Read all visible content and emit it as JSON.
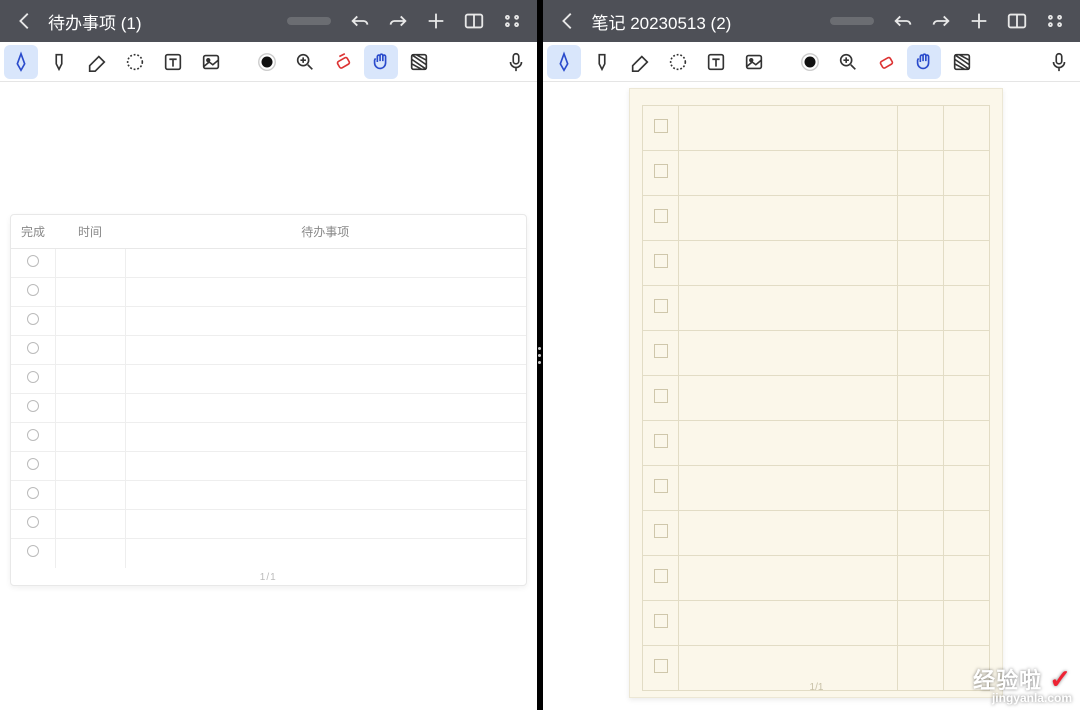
{
  "left": {
    "title": "待办事项 (1)",
    "todo": {
      "headers": {
        "done": "完成",
        "time": "时间",
        "task": "待办事项"
      },
      "rows": 11,
      "page": "1/1"
    }
  },
  "right": {
    "title": "笔记 20230513 (2)",
    "note": {
      "rows": 13,
      "page": "1/1"
    }
  },
  "icons": {
    "back": "back-icon",
    "undo": "undo-icon",
    "redo": "redo-icon",
    "plus": "plus-icon",
    "split": "split-icon",
    "more": "more-icon",
    "pen": "pen-icon",
    "highlighter": "highlighter-icon",
    "eraser": "eraser-icon",
    "lasso": "lasso-icon",
    "text": "text-icon",
    "image": "image-icon",
    "color": "color-icon",
    "zoom": "zoom-icon",
    "erasertool": "eraser-tool-icon",
    "hand": "hand-icon",
    "pattern": "pattern-icon",
    "mic": "mic-icon"
  },
  "colors": {
    "accent": "#3a66ff",
    "eraser": "#d33"
  },
  "watermark": {
    "top": "经验啦",
    "check": "✓",
    "bottom": "jingyanla.com"
  }
}
